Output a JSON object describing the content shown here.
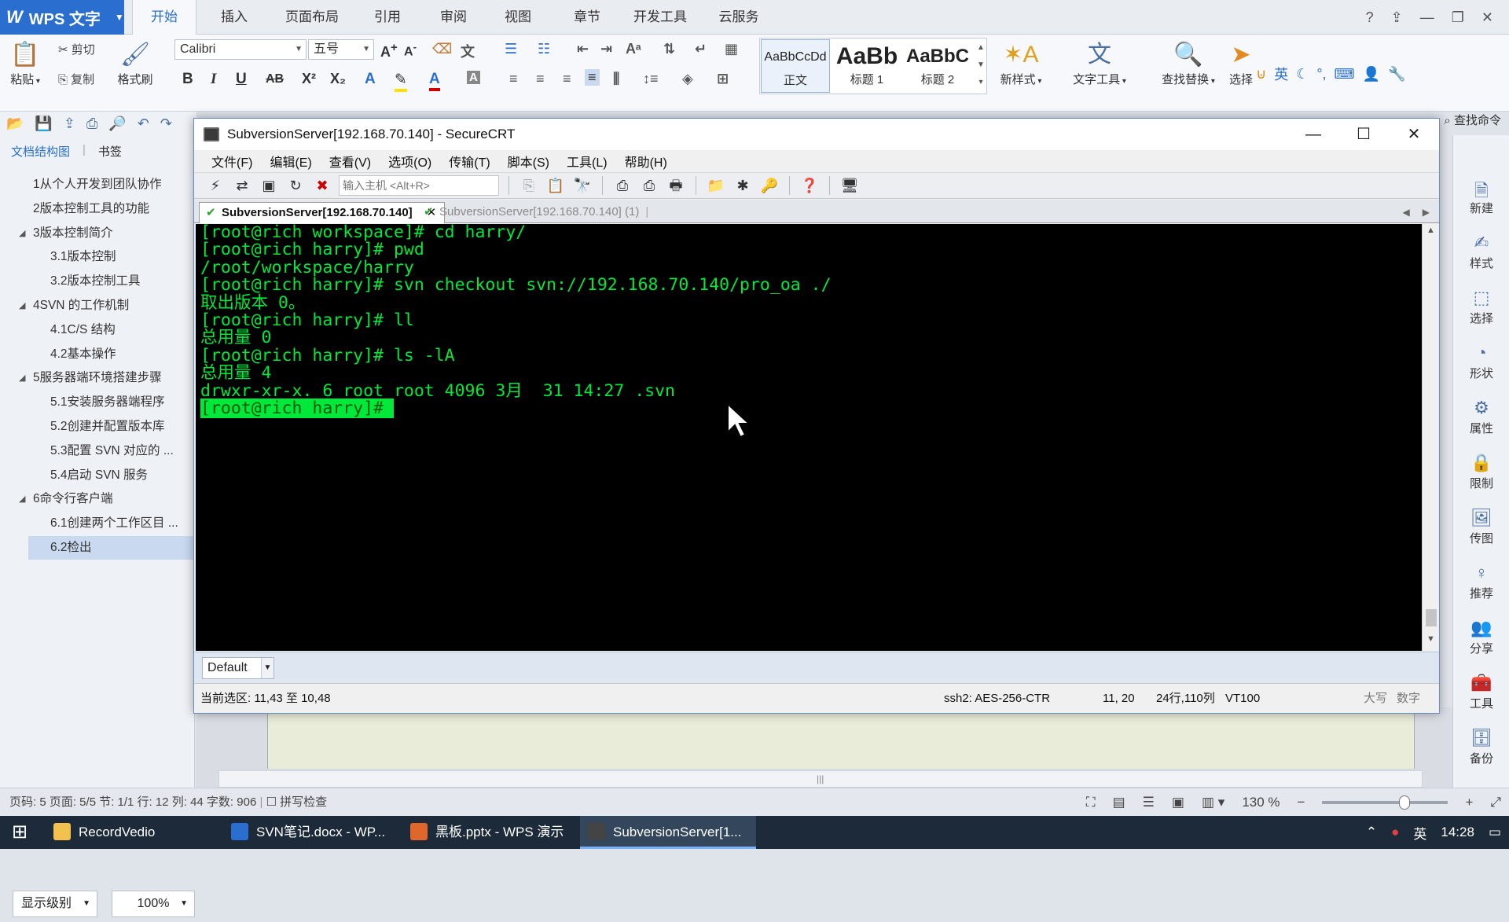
{
  "wps": {
    "app_title": "WPS 文字",
    "ribbon_tabs": [
      "开始",
      "插入",
      "页面布局",
      "引用",
      "审阅",
      "视图",
      "章节",
      "开发工具",
      "云服务"
    ],
    "active_tab": "开始",
    "clipboard": {
      "paste": "粘贴",
      "cut": "剪切",
      "copy": "复制",
      "format_painter": "格式刷"
    },
    "font_name": "Calibri",
    "font_size": "五号",
    "styles": [
      {
        "sample": "AaBbCcDd",
        "label": "正文"
      },
      {
        "sample": "AaBb",
        "label": "标题 1"
      },
      {
        "sample": "AaBbC",
        "label": "标题 2"
      }
    ],
    "new_style": "新样式",
    "text_tool": "文字工具",
    "find_replace": "查找替换",
    "select": "选择",
    "ime": "英",
    "find_cmd": "查找命令"
  },
  "nav": {
    "tabs": [
      "文档结构图",
      "书签"
    ],
    "items": [
      {
        "text": "1从个人开发到团队协作",
        "level": 1
      },
      {
        "text": "2版本控制工具的功能",
        "level": 1
      },
      {
        "text": "3版本控制简介",
        "level": 1,
        "expanded": true
      },
      {
        "text": "3.1版本控制",
        "level": 2
      },
      {
        "text": "3.2版本控制工具",
        "level": 2
      },
      {
        "text": "4SVN 的工作机制",
        "level": 1,
        "expanded": true
      },
      {
        "text": "4.1C/S 结构",
        "level": 2
      },
      {
        "text": "4.2基本操作",
        "level": 2
      },
      {
        "text": "5服务器端环境搭建步骤",
        "level": 1,
        "expanded": true
      },
      {
        "text": "5.1安装服务器端程序",
        "level": 2
      },
      {
        "text": "5.2创建并配置版本库",
        "level": 2
      },
      {
        "text": "5.3配置 SVN 对应的 ...",
        "level": 2
      },
      {
        "text": "5.4启动 SVN 服务",
        "level": 2
      },
      {
        "text": "6命令行客户端",
        "level": 1,
        "expanded": true
      },
      {
        "text": "6.1创建两个工作区目 ...",
        "level": 2
      },
      {
        "text": "6.2检出",
        "level": 2,
        "selected": true
      }
    ],
    "level_label": "显示级别",
    "zoom": "100%"
  },
  "right_panel": [
    "新建",
    "样式",
    "选择",
    "形状",
    "属性",
    "限制",
    "传图",
    "推荐",
    "分享",
    "工具",
    "备份"
  ],
  "status": {
    "left": "页码: 5  页面: 5/5  节: 1/1  行: 12  列: 44  字数: 906",
    "spell": "拼写检查",
    "zoom": "130 %"
  },
  "taskbar": {
    "items": [
      {
        "label": "RecordVedio",
        "color": "#f2c14e"
      },
      {
        "label": "SVN笔记.docx - WP...",
        "color": "#2a6fd0"
      },
      {
        "label": "黑板.pptx - WPS 演示",
        "color": "#e0672b"
      },
      {
        "label": "SubversionServer[1...",
        "color": "#444444",
        "active": true
      }
    ],
    "ime": "英",
    "time": "14:28"
  },
  "crt": {
    "title": "SubversionServer[192.168.70.140] - SecureCRT",
    "menu": [
      "文件(F)",
      "编辑(E)",
      "查看(V)",
      "选项(O)",
      "传输(T)",
      "脚本(S)",
      "工具(L)",
      "帮助(H)"
    ],
    "host_placeholder": "输入主机 <Alt+R>",
    "tabs": [
      {
        "label": "SubversionServer[192.168.70.140]",
        "active": true
      },
      {
        "label": "SubversionServer[192.168.70.140] (1)",
        "active": false
      }
    ],
    "terminal": [
      "[root@rich workspace]# cd harry/",
      "[root@rich harry]# pwd",
      "/root/workspace/harry",
      "[root@rich harry]# svn checkout svn://192.168.70.140/pro_oa ./",
      "取出版本 0。",
      "[root@rich harry]# ll",
      "总用量 0",
      "[root@rich harry]# ls -lA",
      "总用量 4",
      "drwxr-xr-x. 6 root root 4096 3月  31 14:27 .svn",
      "[root@rich harry]# "
    ],
    "session": "Default",
    "status": {
      "selection": "当前选区: 11,43 至 10,48",
      "cipher": "ssh2: AES-256-CTR",
      "cursor": "11,  20",
      "size": "24行,110列",
      "term": "VT100",
      "caps": "大写",
      "num": "数字"
    }
  }
}
